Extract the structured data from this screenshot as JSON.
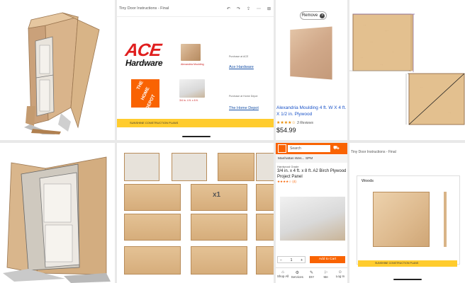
{
  "pdf_viewer": {
    "title": "Tiny Door Instructions - Final",
    "toolbar_icons": [
      "undo-icon",
      "redo-icon",
      "share-icon",
      "more-icon"
    ],
    "ace_brand_word": "ACE",
    "ace_brand_sub": "Hardware",
    "homedepot_brand_line1": "THE",
    "homedepot_brand_line2": "HOME",
    "homedepot_brand_line3": "DEPOT",
    "ace_link": "Ace Hardware",
    "homedepot_link": "The Home Depot",
    "footer_text": "SUNSHINE  CONSTRUCTION PLANS",
    "ace_caption": "Purchase at ACE",
    "ace_item_note": "Alexandria Moulding",
    "hd_caption": "Purchase at Home Depot",
    "hd_item_note": "3/4 in. 4 ft. x 8 ft."
  },
  "amazon": {
    "remove_label": "Remove",
    "product_title": "Alexandria Moulding 4 ft. W X 4 ft. X 1/2 in. Plywood",
    "stars": "★★★★☆",
    "reviews": "3 Reviews",
    "price": "$54.99"
  },
  "homedepot_mobile": {
    "search_placeholder": "Search",
    "store_line": "Manhattan Wes...  SPM",
    "brand": "Hardwood Grade",
    "product_title": "3/4 in. x 4 ft. x 8 ft. A2 Birch Plywood Project Panel",
    "stars": "★★★★☆ (4)",
    "qty_minus": "−",
    "qty_value": "1",
    "qty_plus": "+",
    "add_to_cart": "Add to Cart",
    "tabs": [
      {
        "icon": "⌂",
        "label": "Shop All"
      },
      {
        "icon": "⚙",
        "label": "Services"
      },
      {
        "icon": "✎",
        "label": "DIY"
      },
      {
        "icon": "⚐",
        "label": "Me"
      },
      {
        "icon": "☺",
        "label": "Log In"
      }
    ]
  },
  "tile8": {
    "title": "Tiny Door Instructions - Final",
    "card_label": "Woods",
    "footer_text": "SUNSHINE  CONSTRUCTION PLANS"
  },
  "cutlist": {
    "multiplier": "x1"
  },
  "colors": {
    "ace_red": "#e01e1e",
    "hd_orange": "#f96302",
    "footer_yellow": "#ffcc2e",
    "plywood": "#d6ad7b",
    "link_blue": "#1a53a8"
  }
}
